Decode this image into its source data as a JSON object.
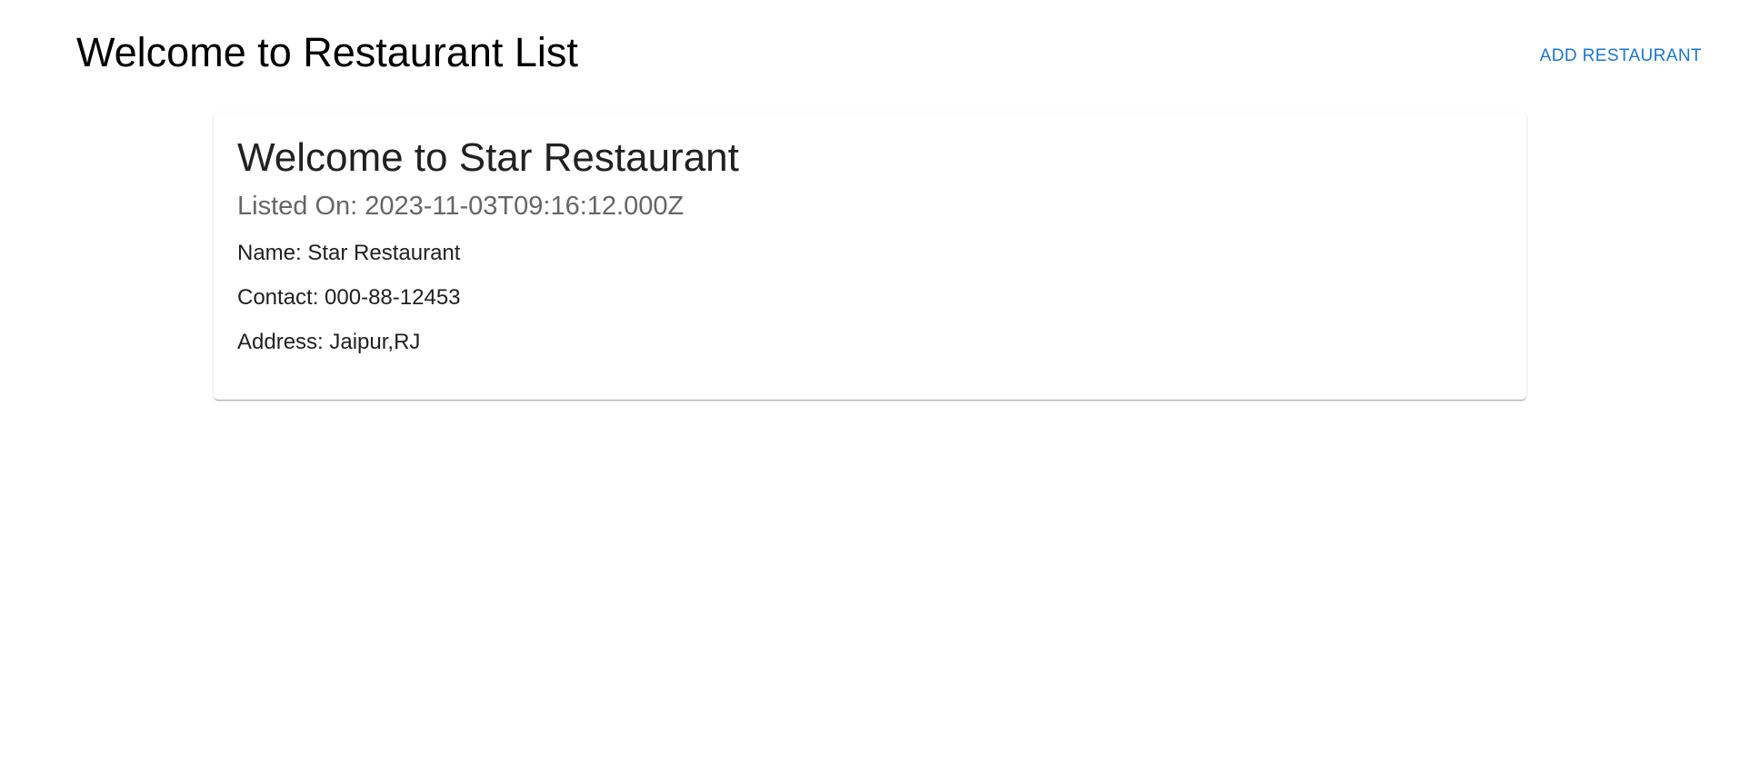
{
  "header": {
    "title": "Welcome to Restaurant List",
    "add_button_label": "ADD RESTAURANT"
  },
  "colors": {
    "accent": "#1976d2",
    "subtitle": "#666666"
  },
  "restaurants": [
    {
      "title": "Welcome to Star Restaurant",
      "listed_on": "Listed On: 2023-11-03T09:16:12.000Z",
      "name": "Name: Star Restaurant",
      "contact": "Contact: 000-88-12453",
      "address": "Address: Jaipur,RJ"
    }
  ]
}
